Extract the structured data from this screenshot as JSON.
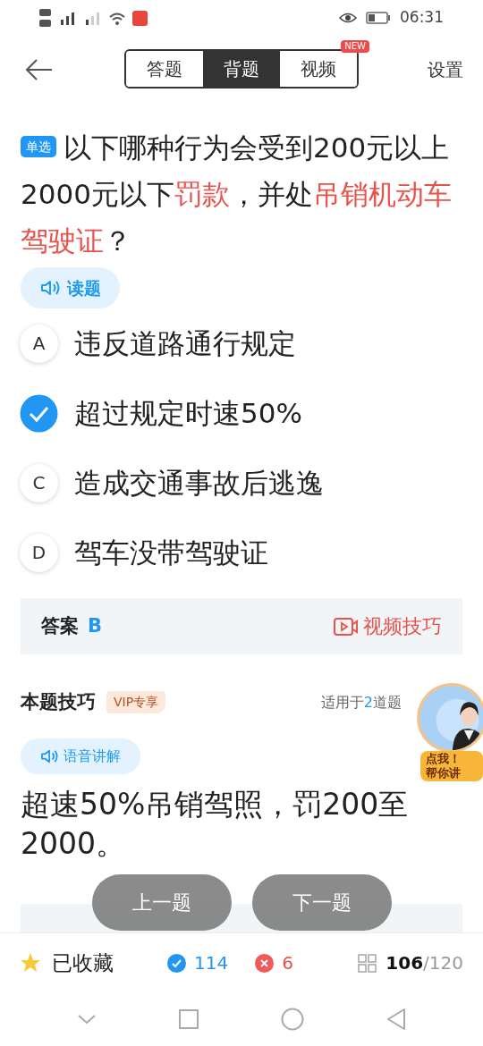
{
  "status_bar": {
    "time": "06:31"
  },
  "header": {
    "tabs": [
      {
        "label": "答题",
        "selected": false
      },
      {
        "label": "背题",
        "selected": true
      },
      {
        "label": "视频",
        "selected": false,
        "badge": "NEW"
      }
    ],
    "settings": "设置"
  },
  "question": {
    "type_badge": "单选",
    "segments": [
      {
        "kind": "normal",
        "text": "以下哪种行为会受到200元以上2000元以下"
      },
      {
        "kind": "highlight",
        "text": "罚款"
      },
      {
        "kind": "normal",
        "text": "，并处"
      },
      {
        "kind": "highlight",
        "text": "吊销机动车驾驶证"
      },
      {
        "kind": "normal",
        "text": "？"
      }
    ],
    "read_button": "读题"
  },
  "options": [
    {
      "letter": "A",
      "text": "违反道路通行规定",
      "selected": false
    },
    {
      "text": "超过规定时速50%",
      "selected": true
    },
    {
      "letter": "C",
      "text": "造成交通事故后逃逸",
      "selected": false
    },
    {
      "letter": "D",
      "text": "驾车没带驾驶证",
      "selected": false
    }
  ],
  "answer": {
    "label": "答案",
    "value": "B",
    "video_tip": "视频技巧"
  },
  "tips": {
    "title": "本题技巧",
    "vip_badge": "VIP专享",
    "applies_prefix": "适用于",
    "applies_count": "2",
    "applies_suffix": "道题",
    "voice_button": "语音讲解",
    "text": "超速50%吊销驾照，罚200至2000。",
    "helper_lines": [
      "点我！",
      "帮你讲"
    ]
  },
  "nav_buttons": [
    "上一题",
    "下一题"
  ],
  "bottom_bar": {
    "favorite": "已收藏",
    "correct": "114",
    "wrong": "6",
    "current": "106",
    "total": "/120"
  }
}
